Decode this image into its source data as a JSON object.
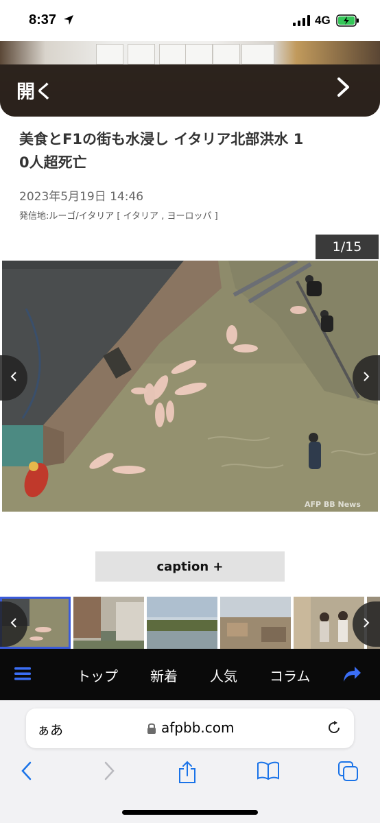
{
  "status_bar": {
    "time": "8:37",
    "network": "4G",
    "location_icon": "location-arrow-icon",
    "signal_icon": "signal-bars-icon",
    "battery_icon": "battery-charging-icon"
  },
  "banner": {
    "label": "開く",
    "next_icon": "chevron-right-icon"
  },
  "article": {
    "title_line1": "美食とF1の街も水浸し イタリア北部洪水 1",
    "title_line2": "0人超死亡",
    "date": "2023年5月19日 14:46",
    "dateline": "発信地:ルーゴ/イタリア [ イタリア , ヨーロッパ ]"
  },
  "gallery": {
    "counter": "1/15",
    "watermark": "AFP BB News",
    "caption_button": "caption +",
    "prev_icon": "chevron-left-icon",
    "next_icon": "chevron-right-icon"
  },
  "site_nav": {
    "menu_icon": "hamburger-menu-icon",
    "items": [
      "トップ",
      "新着",
      "人気",
      "コラム"
    ],
    "share_icon": "share-arrow-icon"
  },
  "browser": {
    "aa_label": "ぁあ",
    "url": "afpbb.com",
    "lock_icon": "lock-icon",
    "reload_icon": "reload-icon",
    "toolbar_icons": [
      "back-icon",
      "forward-icon",
      "share-icon",
      "bookmarks-icon",
      "tabs-icon"
    ]
  },
  "colors": {
    "accent_blue": "#3b5bdb",
    "safari_blue": "#1a73e8",
    "nav_bg": "#0a0a0a",
    "counter_bg": "#3a3a3a"
  }
}
